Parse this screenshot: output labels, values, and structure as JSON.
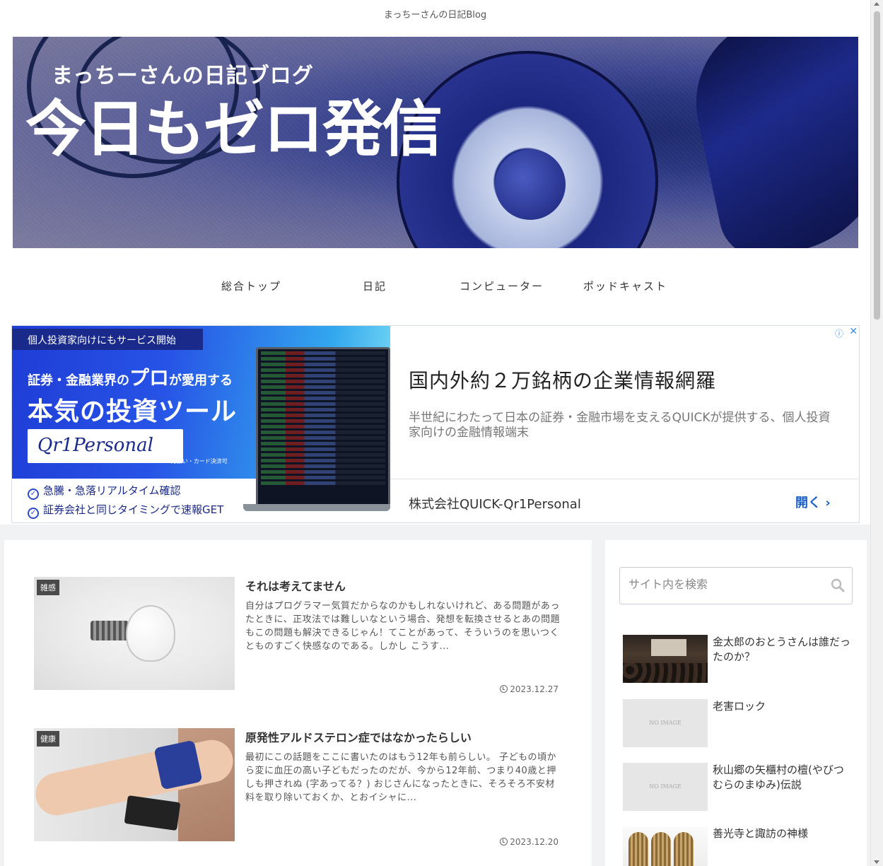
{
  "site": {
    "tagline": "まっちーさんの日記Blog"
  },
  "banner": {
    "subtitle": "まっちーさんの日記ブログ",
    "title": "今日もゼロ発信"
  },
  "nav": {
    "items": [
      {
        "label": "総合トップ"
      },
      {
        "label": "日記"
      },
      {
        "label": "コンピューター"
      },
      {
        "label": "ポッドキャスト"
      }
    ]
  },
  "ad": {
    "badge": "個人投資家向けにもサービス開始",
    "line1_pre": "証券・金融業界の",
    "line1_big": "プロ",
    "line1_post": "が愛用する",
    "line2": "本気の投資ツール",
    "logo": "Qr1Personal",
    "note": "※月払い・カード決済可",
    "checks": [
      "急騰・急落リアルタイム確認",
      "証券会社と同じタイミングで速報GET"
    ],
    "headline": "国内外約２万銘柄の企業情報網羅",
    "description": "半世紀にわたって日本の証券・金融市場を支えるQUICKが提供する、個人投資家向けの金融情報端末",
    "advertiser": "株式会社QUICK-Qr1Personal",
    "open_label": "開く",
    "info_icon": "info-icon",
    "close_icon": "close-icon"
  },
  "posts": [
    {
      "category": "雑感",
      "title": "それは考えてません",
      "excerpt": "自分はプログラマー気質だからなのかもしれないけれど、ある問題があったときに、正攻法では難しいなという場合、発想を転換させるとあの問題もこの問題も解決できるじゃん！てことがあって、そういうのを思いつくとものすごく快感なのである。しかし こうす...",
      "date": "2023.12.27"
    },
    {
      "category": "健康",
      "title": "原発性アルドステロン症ではなかったらしい",
      "excerpt": "最初にこの話題をここに書いたのはもう12年も前らしい。 子どもの頃から変に血圧の高い子どもだったのだが、今から12年前、つまり40歳と押しも押されぬ (字あってる？) おじさんになったときに、そろそろ不安材料を取り除いておくか、とおイシャに...",
      "date": "2023.12.20"
    }
  ],
  "sidebar": {
    "search_placeholder": "サイト内を検索",
    "noimage_label": "NO IMAGE",
    "items": [
      {
        "title": "金太郎のおとうさんは誰だったのか？"
      },
      {
        "title": "老害ロック"
      },
      {
        "title": "秋山郷の矢櫃村の檀(やびつむらのまゆみ)伝説"
      },
      {
        "title": "善光寺と諏訪の神様"
      }
    ]
  },
  "colors": {
    "accent_link": "#1a5fc8",
    "ad_blue": "#1a2a8a",
    "content_bg": "#f0f2f4"
  }
}
